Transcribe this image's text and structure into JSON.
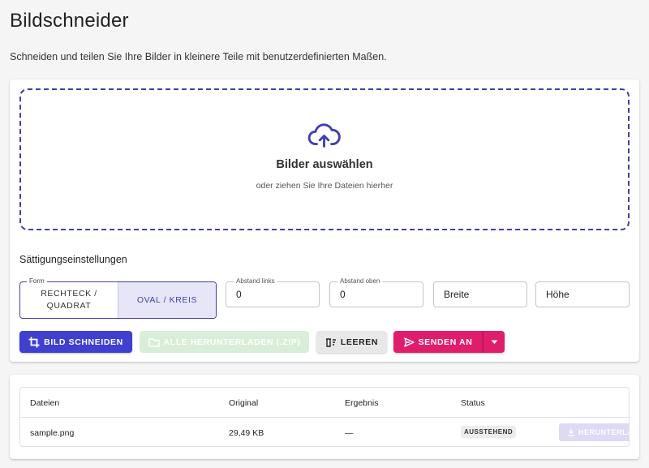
{
  "page": {
    "title": "Bildschneider",
    "subtitle": "Schneiden und teilen Sie Ihre Bilder in kleinere Teile mit benutzerdefinierten Maßen."
  },
  "dropzone": {
    "icon": "cloud-upload-icon",
    "title": "Bilder auswählen",
    "subtitle": "oder ziehen Sie Ihre Dateien hierher"
  },
  "settings": {
    "label": "Sättigungseinstellungen",
    "form": {
      "legend": "Form",
      "options": [
        "RECHTECK / QUADRAT",
        "OVAL / KREIS"
      ],
      "selected": "OVAL / KREIS"
    },
    "margin_left": {
      "label": "Abstand links",
      "value": "0"
    },
    "margin_top": {
      "label": "Abstand oben",
      "value": "0"
    },
    "width": {
      "placeholder": "Breite"
    },
    "height": {
      "placeholder": "Höhe"
    }
  },
  "actions": {
    "crop": "BILD SCHNEIDEN",
    "download_all": "ALLE HERUNTERLADEN (.ZIP)",
    "clear": "LEEREN",
    "send": "SENDEN AN"
  },
  "colors": {
    "primary": "#3f3fd0",
    "accent": "#e01d6a",
    "disabled_green": "#d8eed8"
  },
  "table": {
    "headers": [
      "Dateien",
      "Original",
      "Ergebnis",
      "Status"
    ],
    "rows": [
      {
        "file": "sample.png",
        "original": "29,49 KB",
        "result": "—",
        "status": "AUSSTEHEND",
        "action": "HERUNTERLADEN"
      }
    ]
  }
}
